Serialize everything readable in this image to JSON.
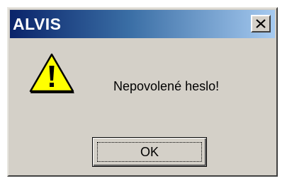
{
  "window": {
    "title": "ALVIS",
    "close_icon": "close-icon",
    "colors": {
      "titlebar_start": "#0a246a",
      "titlebar_end": "#a6caf0",
      "dialog_face": "#d4d0c8"
    }
  },
  "body": {
    "icon": "warning-icon",
    "message": "Nepovolené heslo!"
  },
  "buttons": {
    "ok_label": "OK"
  }
}
